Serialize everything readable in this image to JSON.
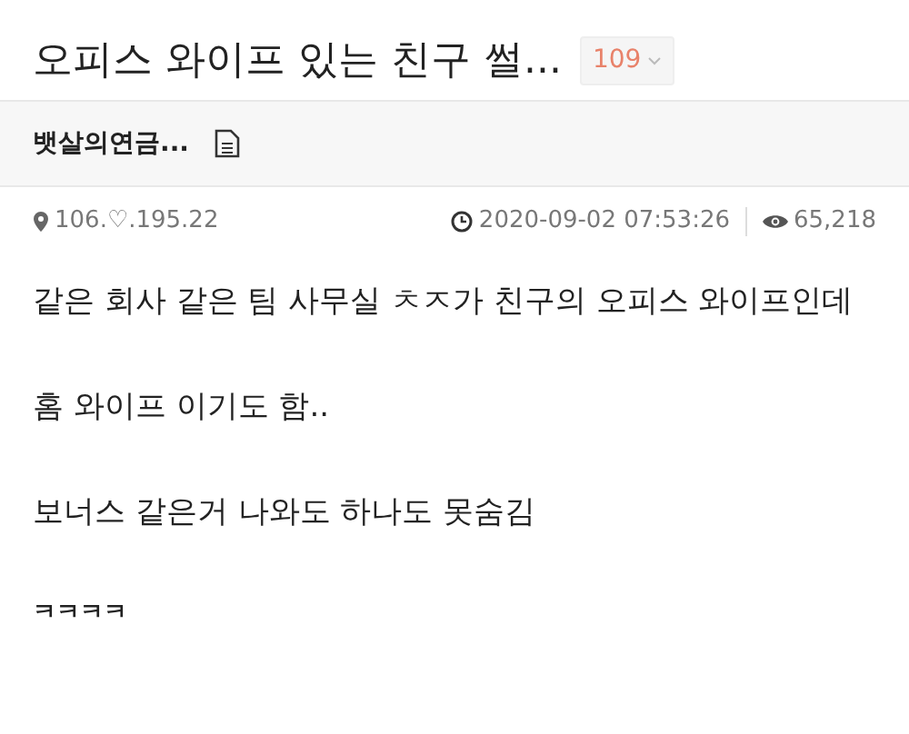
{
  "title": "오피스 와이프 있는 친구 썰...",
  "comment_count": "109",
  "author": "뱃살의연금...",
  "meta": {
    "ip": "106.♡.195.22",
    "datetime": "2020-09-02 07:53:26",
    "views": "65,218"
  },
  "body": [
    {
      "kind": "paragraph",
      "text": "같은 회사 같은 팀 사무실 ㅊㅈ가 친구의 오피스 와이프인데"
    },
    {
      "kind": "paragraph",
      "text": "홈 와이프 이기도 함.."
    },
    {
      "kind": "paragraph",
      "text": "보너스 같은거 나와도 하나도 못숨김"
    },
    {
      "kind": "small",
      "text": "ㅋㅋㅋㅋ"
    }
  ]
}
